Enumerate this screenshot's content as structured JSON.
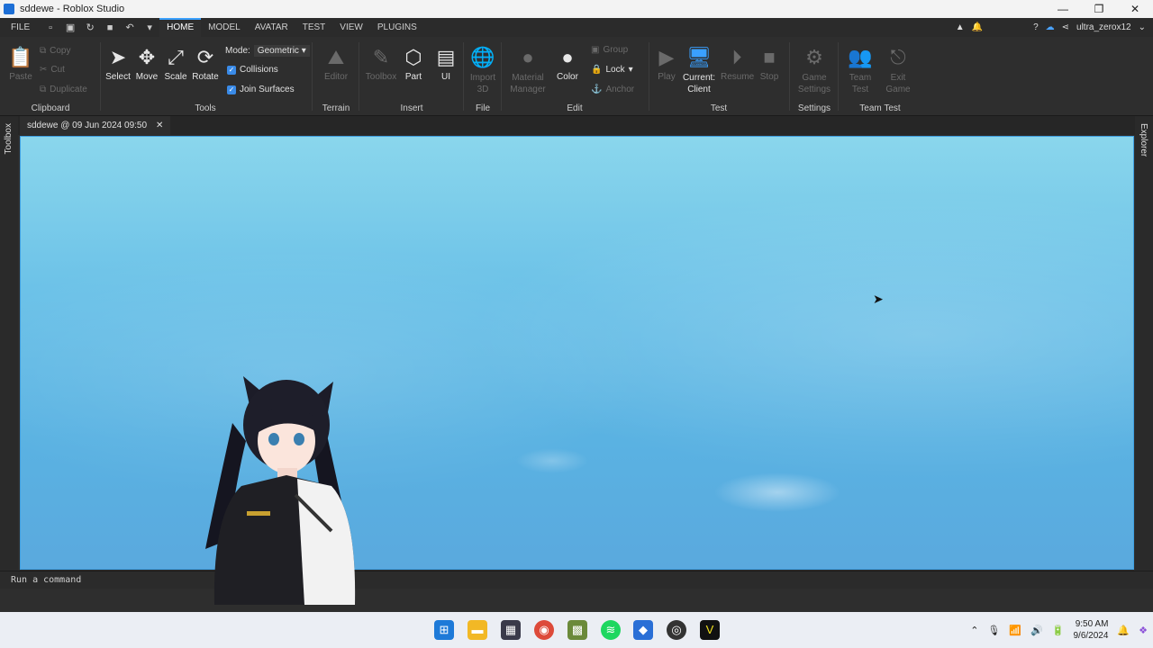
{
  "window": {
    "title": "sddewe - Roblox Studio"
  },
  "menu": {
    "file": "FILE",
    "tabs": [
      "HOME",
      "MODEL",
      "AVATAR",
      "TEST",
      "VIEW",
      "PLUGINS"
    ],
    "username": "ultra_zerox12"
  },
  "ribbon": {
    "clipboard": {
      "label": "Clipboard",
      "paste": "Paste",
      "copy": "Copy",
      "cut": "Cut",
      "duplicate": "Duplicate"
    },
    "tools": {
      "label": "Tools",
      "select": "Select",
      "move": "Move",
      "scale": "Scale",
      "rotate": "Rotate",
      "mode_label": "Mode:",
      "mode_value": "Geometric",
      "collisions": "Collisions",
      "join_surfaces": "Join Surfaces"
    },
    "terrain": {
      "label": "Terrain",
      "editor": "Editor"
    },
    "insert": {
      "label": "Insert",
      "toolbox": "Toolbox",
      "part": "Part",
      "ui": "UI"
    },
    "file": {
      "label": "File",
      "import_line1": "Import",
      "import_line2": "3D"
    },
    "edit": {
      "label": "Edit",
      "material_line1": "Material",
      "material_line2": "Manager",
      "color": "Color",
      "group": "Group",
      "lock": "Lock",
      "anchor": "Anchor"
    },
    "test": {
      "label": "Test",
      "play": "Play",
      "current_line1": "Current:",
      "current_line2": "Client",
      "resume": "Resume",
      "stop": "Stop"
    },
    "settings": {
      "label": "Settings",
      "game_line1": "Game",
      "game_line2": "Settings"
    },
    "team_test": {
      "label": "Team Test",
      "team_line1": "Team",
      "team_line2": "Test",
      "exit_line1": "Exit",
      "exit_line2": "Game"
    }
  },
  "document_tab": {
    "label": "sddewe @ 09 Jun 2024 09:50"
  },
  "side_panels": {
    "left": "Toolbox",
    "right": "Explorer"
  },
  "command_bar": {
    "placeholder": "Run a command"
  },
  "taskbar": {
    "time": "9:50 AM",
    "date": "9/6/2024"
  }
}
